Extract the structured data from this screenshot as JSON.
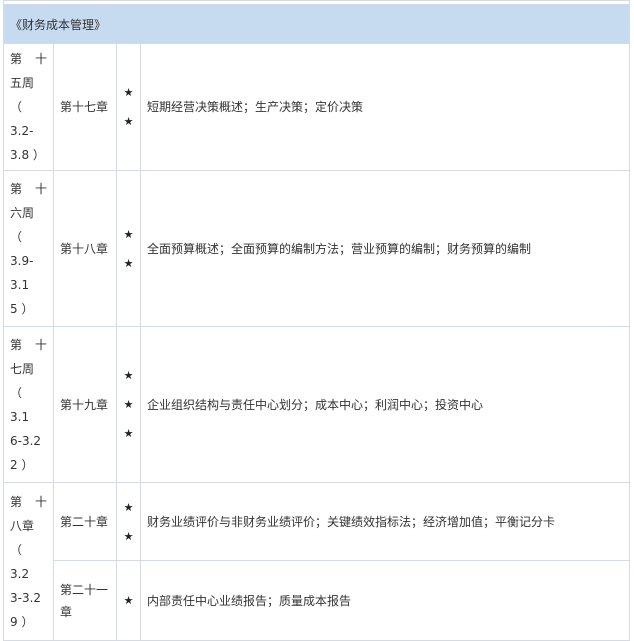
{
  "header": {
    "title": "《财务成本管理》"
  },
  "weeks": [
    {
      "lines": [
        "第　十",
        "五周",
        "（ 3.2-",
        "3.8 ）"
      ]
    },
    {
      "lines": [
        "第　十",
        "六周",
        "（ 3.9-",
        "3.1",
        "5 ）"
      ]
    },
    {
      "lines": [
        "第　十",
        "七周",
        "（　3.1",
        "6-3.2",
        "2 ）"
      ]
    },
    {
      "lines": [
        "第　十",
        "八章",
        "（　3.2",
        "3-3.2",
        "9 ）"
      ]
    }
  ],
  "rows": [
    {
      "chapter": "第十七章",
      "star_count": 2,
      "topic": "短期经营决策概述；生产决策；定价决策"
    },
    {
      "chapter": "第十八章",
      "star_count": 2,
      "topic": "全面预算概述；全面预算的编制方法；营业预算的编制；财务预算的编制"
    },
    {
      "chapter": "第十九章",
      "star_count": 3,
      "topic": "企业组织结构与责任中心划分；成本中心；利润中心；投资中心"
    },
    {
      "chapter": "第二十章",
      "star_count": 2,
      "topic": "财务业绩评价与非财务业绩评价；关键绩效指标法；经济增加值；平衡记分卡"
    },
    {
      "chapter_lines": [
        "第二十一",
        "章"
      ],
      "star_count": 1,
      "topic": "内部责任中心业绩报告；质量成本报告"
    }
  ],
  "icons": {
    "star": "★"
  }
}
